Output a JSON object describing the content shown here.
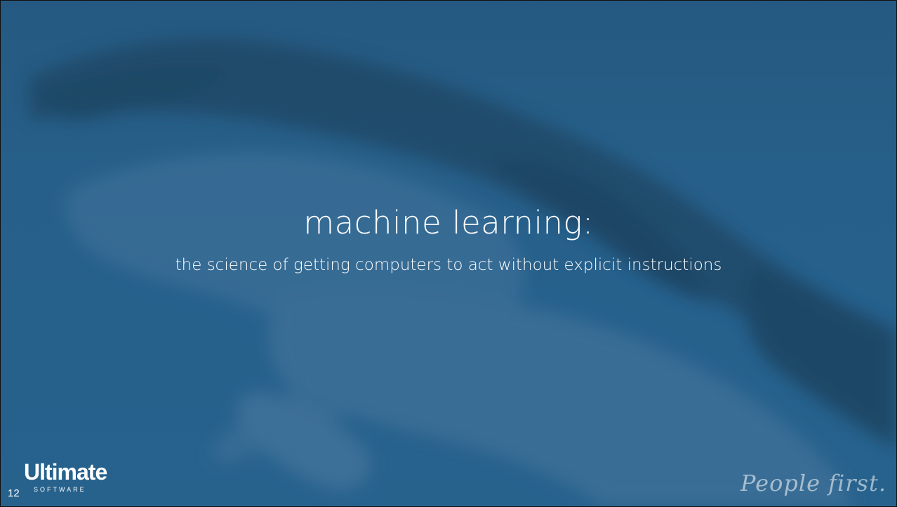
{
  "slide": {
    "title": "machine learning:",
    "subtitle": "the science of getting computers to act without explicit instructions",
    "number": "12"
  },
  "branding": {
    "logo_word": "Ultimate",
    "logo_sub": "SOFTWARE",
    "tagline": "People first."
  },
  "colors": {
    "background": "#2c6893",
    "text": "#ffffff"
  }
}
